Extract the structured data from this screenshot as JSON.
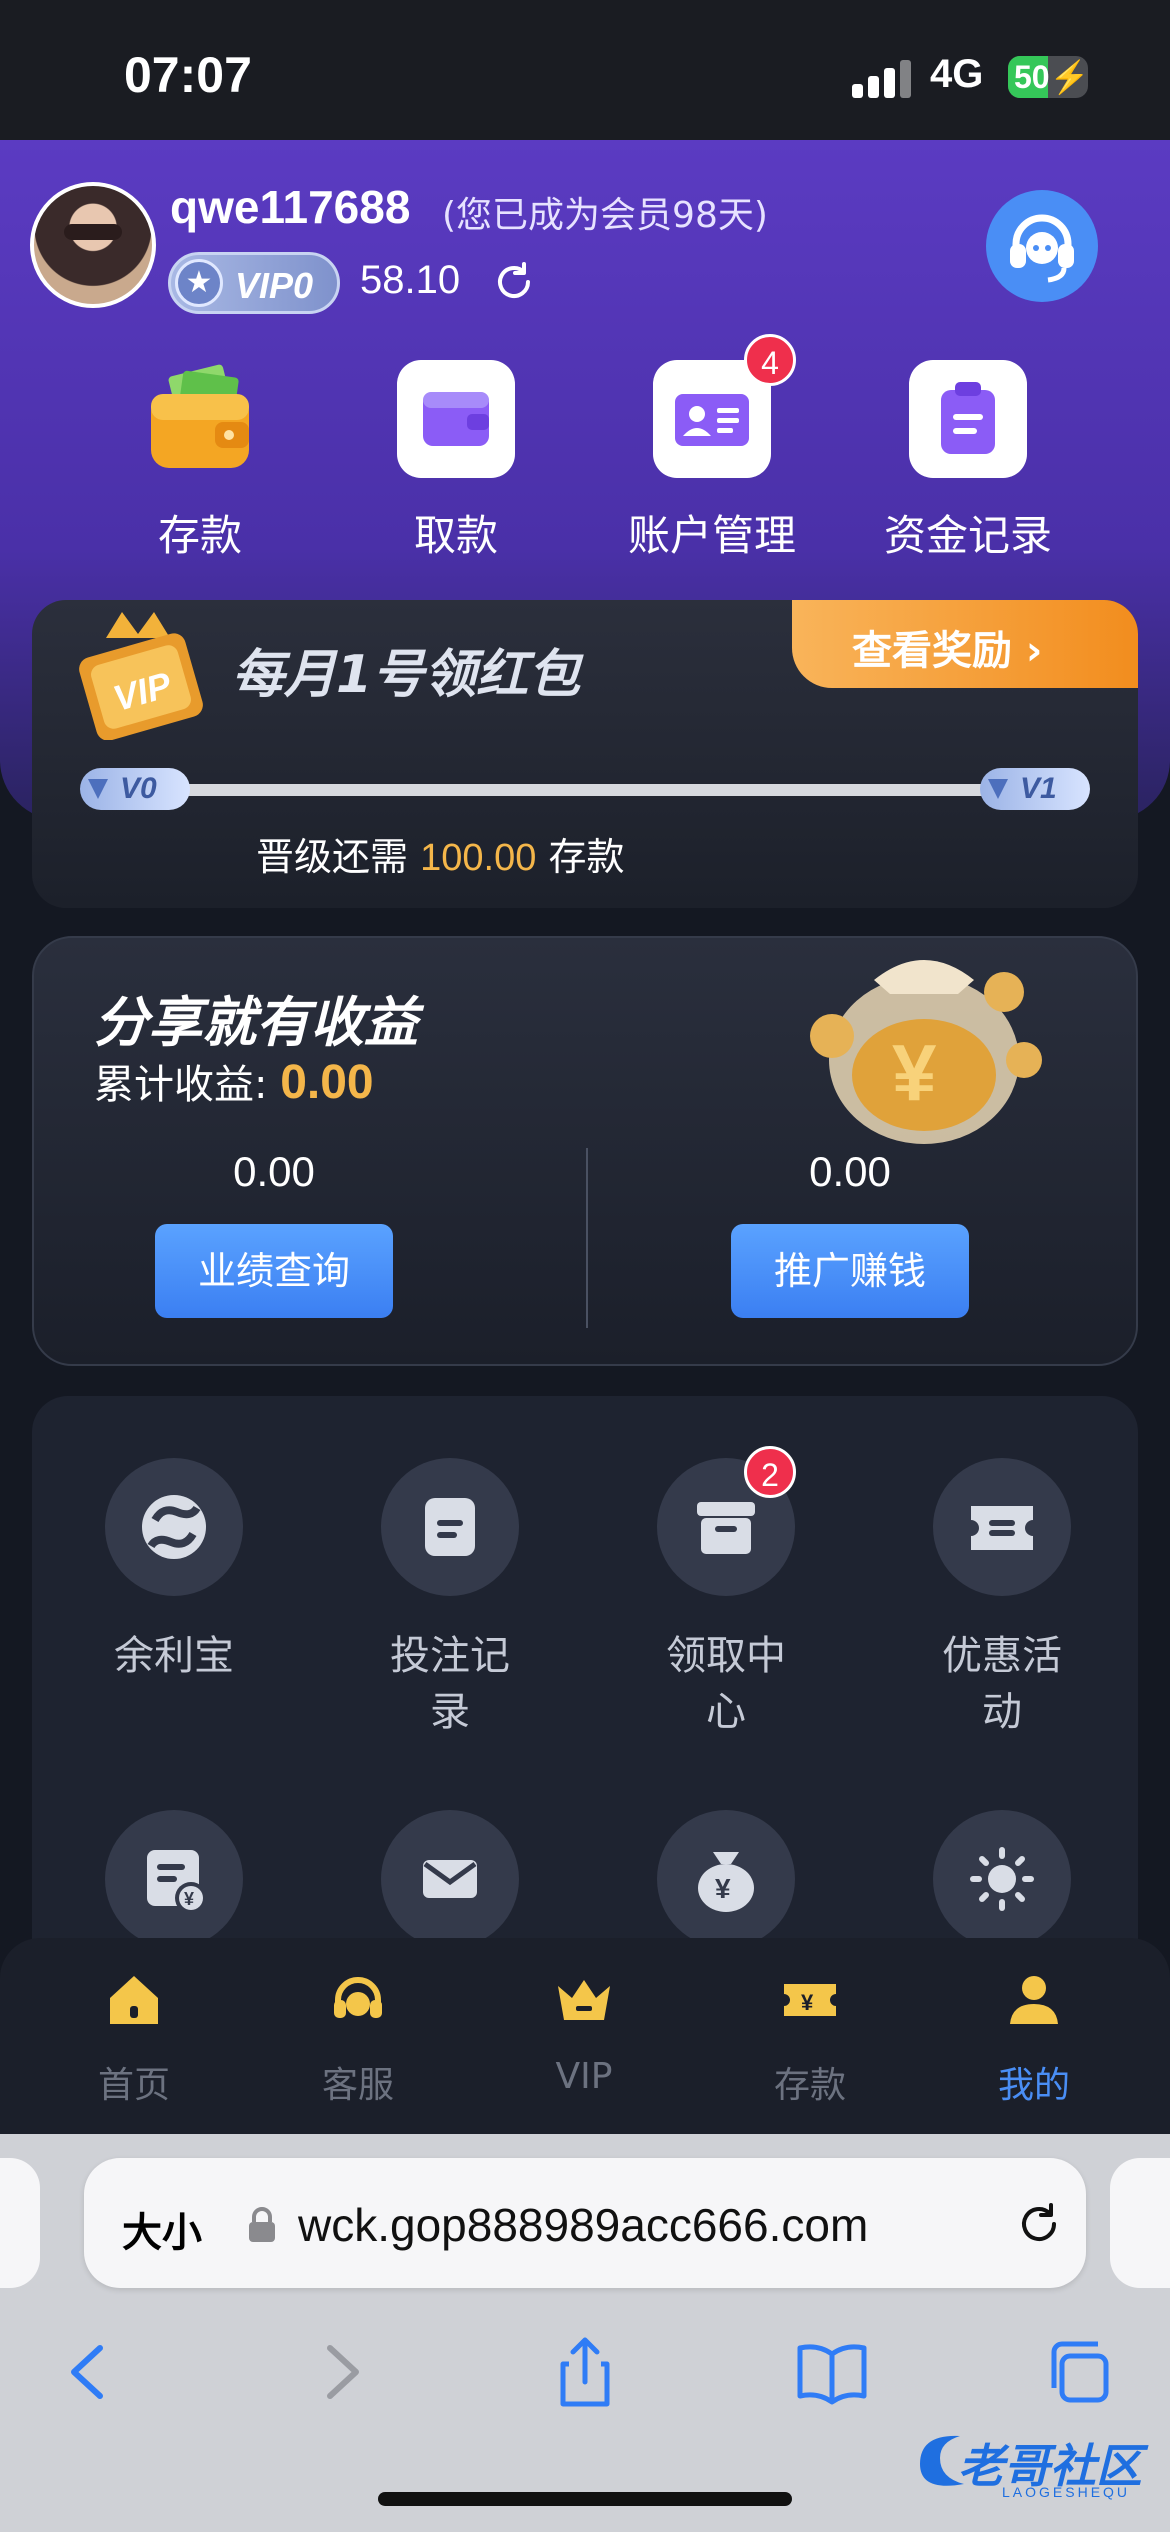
{
  "status_bar": {
    "time": "07:07",
    "network": "4G",
    "battery_level": 50,
    "battery_text": "50"
  },
  "profile": {
    "username": "qwe117688",
    "member_note": "(您已成为会员98天)",
    "vip_level": "VIP0",
    "balance": "58.10"
  },
  "quick_actions": [
    {
      "label": "存款",
      "icon": "wallet-icon"
    },
    {
      "label": "取款",
      "icon": "withdraw-wallet-icon"
    },
    {
      "label": "账户管理",
      "icon": "id-card-icon",
      "badge": "4"
    },
    {
      "label": "资金记录",
      "icon": "clipboard-icon"
    }
  ],
  "vip_banner": {
    "headline": "每月1号领红包",
    "reward_button": "查看奖励 ›",
    "current_level": "V0",
    "next_level": "V1",
    "progress": 0,
    "upgrade_prefix": "晋级还需",
    "upgrade_amount": "100.00",
    "upgrade_suffix": "存款"
  },
  "share": {
    "title": "分享就有收益",
    "total_label": "累计收益:",
    "total_value": "0.00",
    "left_value": "0.00",
    "left_button": "业绩查询",
    "right_value": "0.00",
    "right_button": "推广赚钱"
  },
  "grid": [
    {
      "label": "余利宝",
      "icon": "yulibao-icon"
    },
    {
      "label": "投注记录",
      "icon": "bet-record-icon"
    },
    {
      "label": "领取中心",
      "icon": "claim-box-icon",
      "badge": "2"
    },
    {
      "label": "优惠活动",
      "icon": "promo-ticket-icon"
    },
    {
      "label": "",
      "icon": "bill-icon"
    },
    {
      "label": "",
      "icon": "mail-icon"
    },
    {
      "label": "",
      "icon": "money-bag-icon"
    },
    {
      "label": "",
      "icon": "settings-sun-icon"
    }
  ],
  "tabs": [
    {
      "label": "首页",
      "icon": "home-icon",
      "active": false
    },
    {
      "label": "客服",
      "icon": "headset-icon",
      "active": false
    },
    {
      "label": "VIP",
      "icon": "crown-icon",
      "active": false
    },
    {
      "label": "存款",
      "icon": "ticket-yen-icon",
      "active": false
    },
    {
      "label": "我的",
      "icon": "user-icon",
      "active": true
    }
  ],
  "browser": {
    "text_size": "大小",
    "url": "wck.gop888989acc666.com"
  },
  "watermark": {
    "text": "老哥社区",
    "sub": "LAOGESHEQU"
  },
  "colors": {
    "accent_blue": "#4a8ef5",
    "gold": "#f4b64a",
    "badge_red": "#ef2f4c",
    "header_purple": "#5b3bc2"
  }
}
